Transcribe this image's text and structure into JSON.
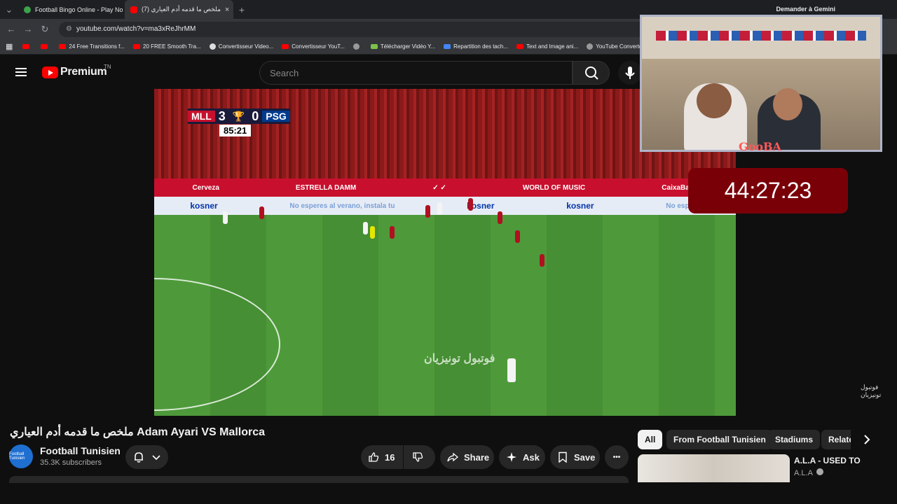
{
  "browser": {
    "tabs": [
      {
        "label": "Football Bingo Online - Play No",
        "close": "×"
      },
      {
        "label": "(7) ملخص ما قدمه أدم العياري",
        "close": "×"
      }
    ],
    "new_tab": "+",
    "url": "youtube.com/watch?v=ma3xReJhrMM",
    "gemini": "Demander à Gemini",
    "bookmarks": [
      "",
      "",
      "24 Free Transitions f...",
      "20 FREE Smooth Tra...",
      "Convertisseur Video...",
      "Convertisseur YouT...",
      "",
      "Télécharger Vidéo Y...",
      "Repartition des tach...",
      "Text and Image ani...",
      "YouTube Converter..."
    ]
  },
  "youtube": {
    "logo": "Premium",
    "country": "TN",
    "search_placeholder": "Search"
  },
  "video": {
    "score_home": "MLL",
    "score_home_goals": "3",
    "score_away_goals": "0",
    "score_away": "PSG",
    "match_clock": "85:21",
    "board_ads": [
      "Cerveza",
      "ESTRELLA DAMM",
      "WORLD OF MUSIC",
      "CaixaBank"
    ],
    "board2_ads": [
      "kosner",
      "No esperes al verano, instala tu",
      "kosner",
      "kosner",
      "No espere"
    ],
    "watermark": "فوتبول تونيزيان"
  },
  "overlay": {
    "streamer": "GooBA",
    "timer": "44:27:23"
  },
  "watch": {
    "title": "ملخص ما قدمه أدم العياري Adam Ayari VS Mallorca",
    "channel_name": "Football Tunisien",
    "channel_avatar_text": "Football Tunisien",
    "subscribers": "35.3K subscribers",
    "likes": "16",
    "share": "Share",
    "ask": "Ask",
    "save": "Save",
    "more": "•••"
  },
  "chips": [
    "All",
    "From Football Tunisien",
    "Stadiums",
    "Related"
  ],
  "recommendation": {
    "title": "A.L.A - USED TO",
    "channel": "A.L.A"
  }
}
